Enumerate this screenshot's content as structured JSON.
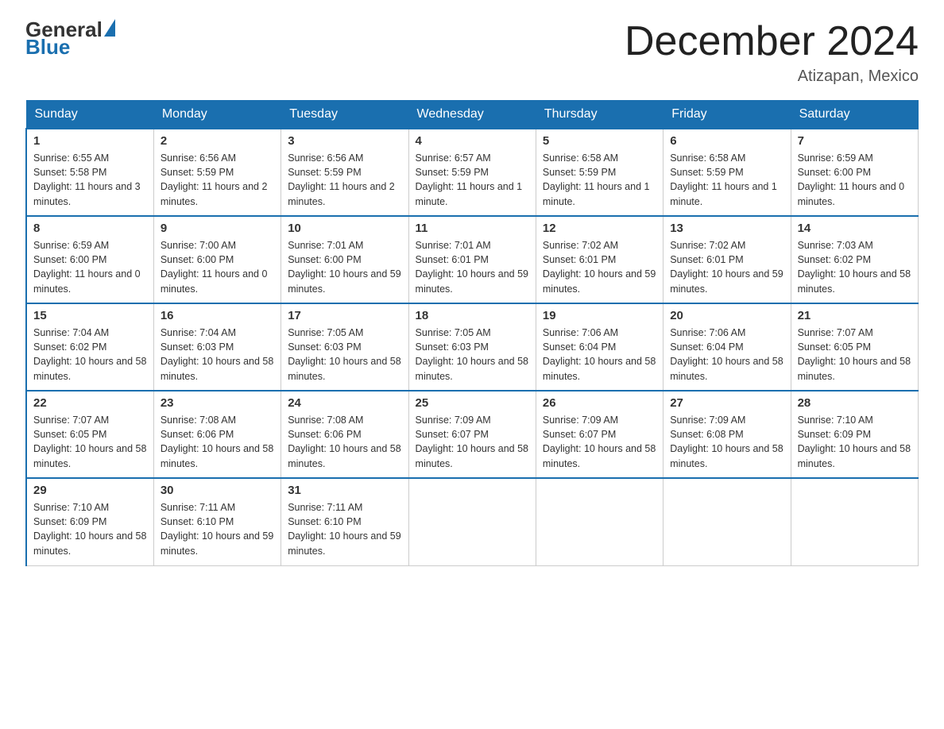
{
  "header": {
    "logo_general": "General",
    "logo_blue": "Blue",
    "title": "December 2024",
    "location": "Atizapan, Mexico"
  },
  "days_of_week": [
    "Sunday",
    "Monday",
    "Tuesday",
    "Wednesday",
    "Thursday",
    "Friday",
    "Saturday"
  ],
  "weeks": [
    [
      {
        "num": "1",
        "sunrise": "6:55 AM",
        "sunset": "5:58 PM",
        "daylight": "11 hours and 3 minutes."
      },
      {
        "num": "2",
        "sunrise": "6:56 AM",
        "sunset": "5:59 PM",
        "daylight": "11 hours and 2 minutes."
      },
      {
        "num": "3",
        "sunrise": "6:56 AM",
        "sunset": "5:59 PM",
        "daylight": "11 hours and 2 minutes."
      },
      {
        "num": "4",
        "sunrise": "6:57 AM",
        "sunset": "5:59 PM",
        "daylight": "11 hours and 1 minute."
      },
      {
        "num": "5",
        "sunrise": "6:58 AM",
        "sunset": "5:59 PM",
        "daylight": "11 hours and 1 minute."
      },
      {
        "num": "6",
        "sunrise": "6:58 AM",
        "sunset": "5:59 PM",
        "daylight": "11 hours and 1 minute."
      },
      {
        "num": "7",
        "sunrise": "6:59 AM",
        "sunset": "6:00 PM",
        "daylight": "11 hours and 0 minutes."
      }
    ],
    [
      {
        "num": "8",
        "sunrise": "6:59 AM",
        "sunset": "6:00 PM",
        "daylight": "11 hours and 0 minutes."
      },
      {
        "num": "9",
        "sunrise": "7:00 AM",
        "sunset": "6:00 PM",
        "daylight": "11 hours and 0 minutes."
      },
      {
        "num": "10",
        "sunrise": "7:01 AM",
        "sunset": "6:00 PM",
        "daylight": "10 hours and 59 minutes."
      },
      {
        "num": "11",
        "sunrise": "7:01 AM",
        "sunset": "6:01 PM",
        "daylight": "10 hours and 59 minutes."
      },
      {
        "num": "12",
        "sunrise": "7:02 AM",
        "sunset": "6:01 PM",
        "daylight": "10 hours and 59 minutes."
      },
      {
        "num": "13",
        "sunrise": "7:02 AM",
        "sunset": "6:01 PM",
        "daylight": "10 hours and 59 minutes."
      },
      {
        "num": "14",
        "sunrise": "7:03 AM",
        "sunset": "6:02 PM",
        "daylight": "10 hours and 58 minutes."
      }
    ],
    [
      {
        "num": "15",
        "sunrise": "7:04 AM",
        "sunset": "6:02 PM",
        "daylight": "10 hours and 58 minutes."
      },
      {
        "num": "16",
        "sunrise": "7:04 AM",
        "sunset": "6:03 PM",
        "daylight": "10 hours and 58 minutes."
      },
      {
        "num": "17",
        "sunrise": "7:05 AM",
        "sunset": "6:03 PM",
        "daylight": "10 hours and 58 minutes."
      },
      {
        "num": "18",
        "sunrise": "7:05 AM",
        "sunset": "6:03 PM",
        "daylight": "10 hours and 58 minutes."
      },
      {
        "num": "19",
        "sunrise": "7:06 AM",
        "sunset": "6:04 PM",
        "daylight": "10 hours and 58 minutes."
      },
      {
        "num": "20",
        "sunrise": "7:06 AM",
        "sunset": "6:04 PM",
        "daylight": "10 hours and 58 minutes."
      },
      {
        "num": "21",
        "sunrise": "7:07 AM",
        "sunset": "6:05 PM",
        "daylight": "10 hours and 58 minutes."
      }
    ],
    [
      {
        "num": "22",
        "sunrise": "7:07 AM",
        "sunset": "6:05 PM",
        "daylight": "10 hours and 58 minutes."
      },
      {
        "num": "23",
        "sunrise": "7:08 AM",
        "sunset": "6:06 PM",
        "daylight": "10 hours and 58 minutes."
      },
      {
        "num": "24",
        "sunrise": "7:08 AM",
        "sunset": "6:06 PM",
        "daylight": "10 hours and 58 minutes."
      },
      {
        "num": "25",
        "sunrise": "7:09 AM",
        "sunset": "6:07 PM",
        "daylight": "10 hours and 58 minutes."
      },
      {
        "num": "26",
        "sunrise": "7:09 AM",
        "sunset": "6:07 PM",
        "daylight": "10 hours and 58 minutes."
      },
      {
        "num": "27",
        "sunrise": "7:09 AM",
        "sunset": "6:08 PM",
        "daylight": "10 hours and 58 minutes."
      },
      {
        "num": "28",
        "sunrise": "7:10 AM",
        "sunset": "6:09 PM",
        "daylight": "10 hours and 58 minutes."
      }
    ],
    [
      {
        "num": "29",
        "sunrise": "7:10 AM",
        "sunset": "6:09 PM",
        "daylight": "10 hours and 58 minutes."
      },
      {
        "num": "30",
        "sunrise": "7:11 AM",
        "sunset": "6:10 PM",
        "daylight": "10 hours and 59 minutes."
      },
      {
        "num": "31",
        "sunrise": "7:11 AM",
        "sunset": "6:10 PM",
        "daylight": "10 hours and 59 minutes."
      },
      null,
      null,
      null,
      null
    ]
  ]
}
